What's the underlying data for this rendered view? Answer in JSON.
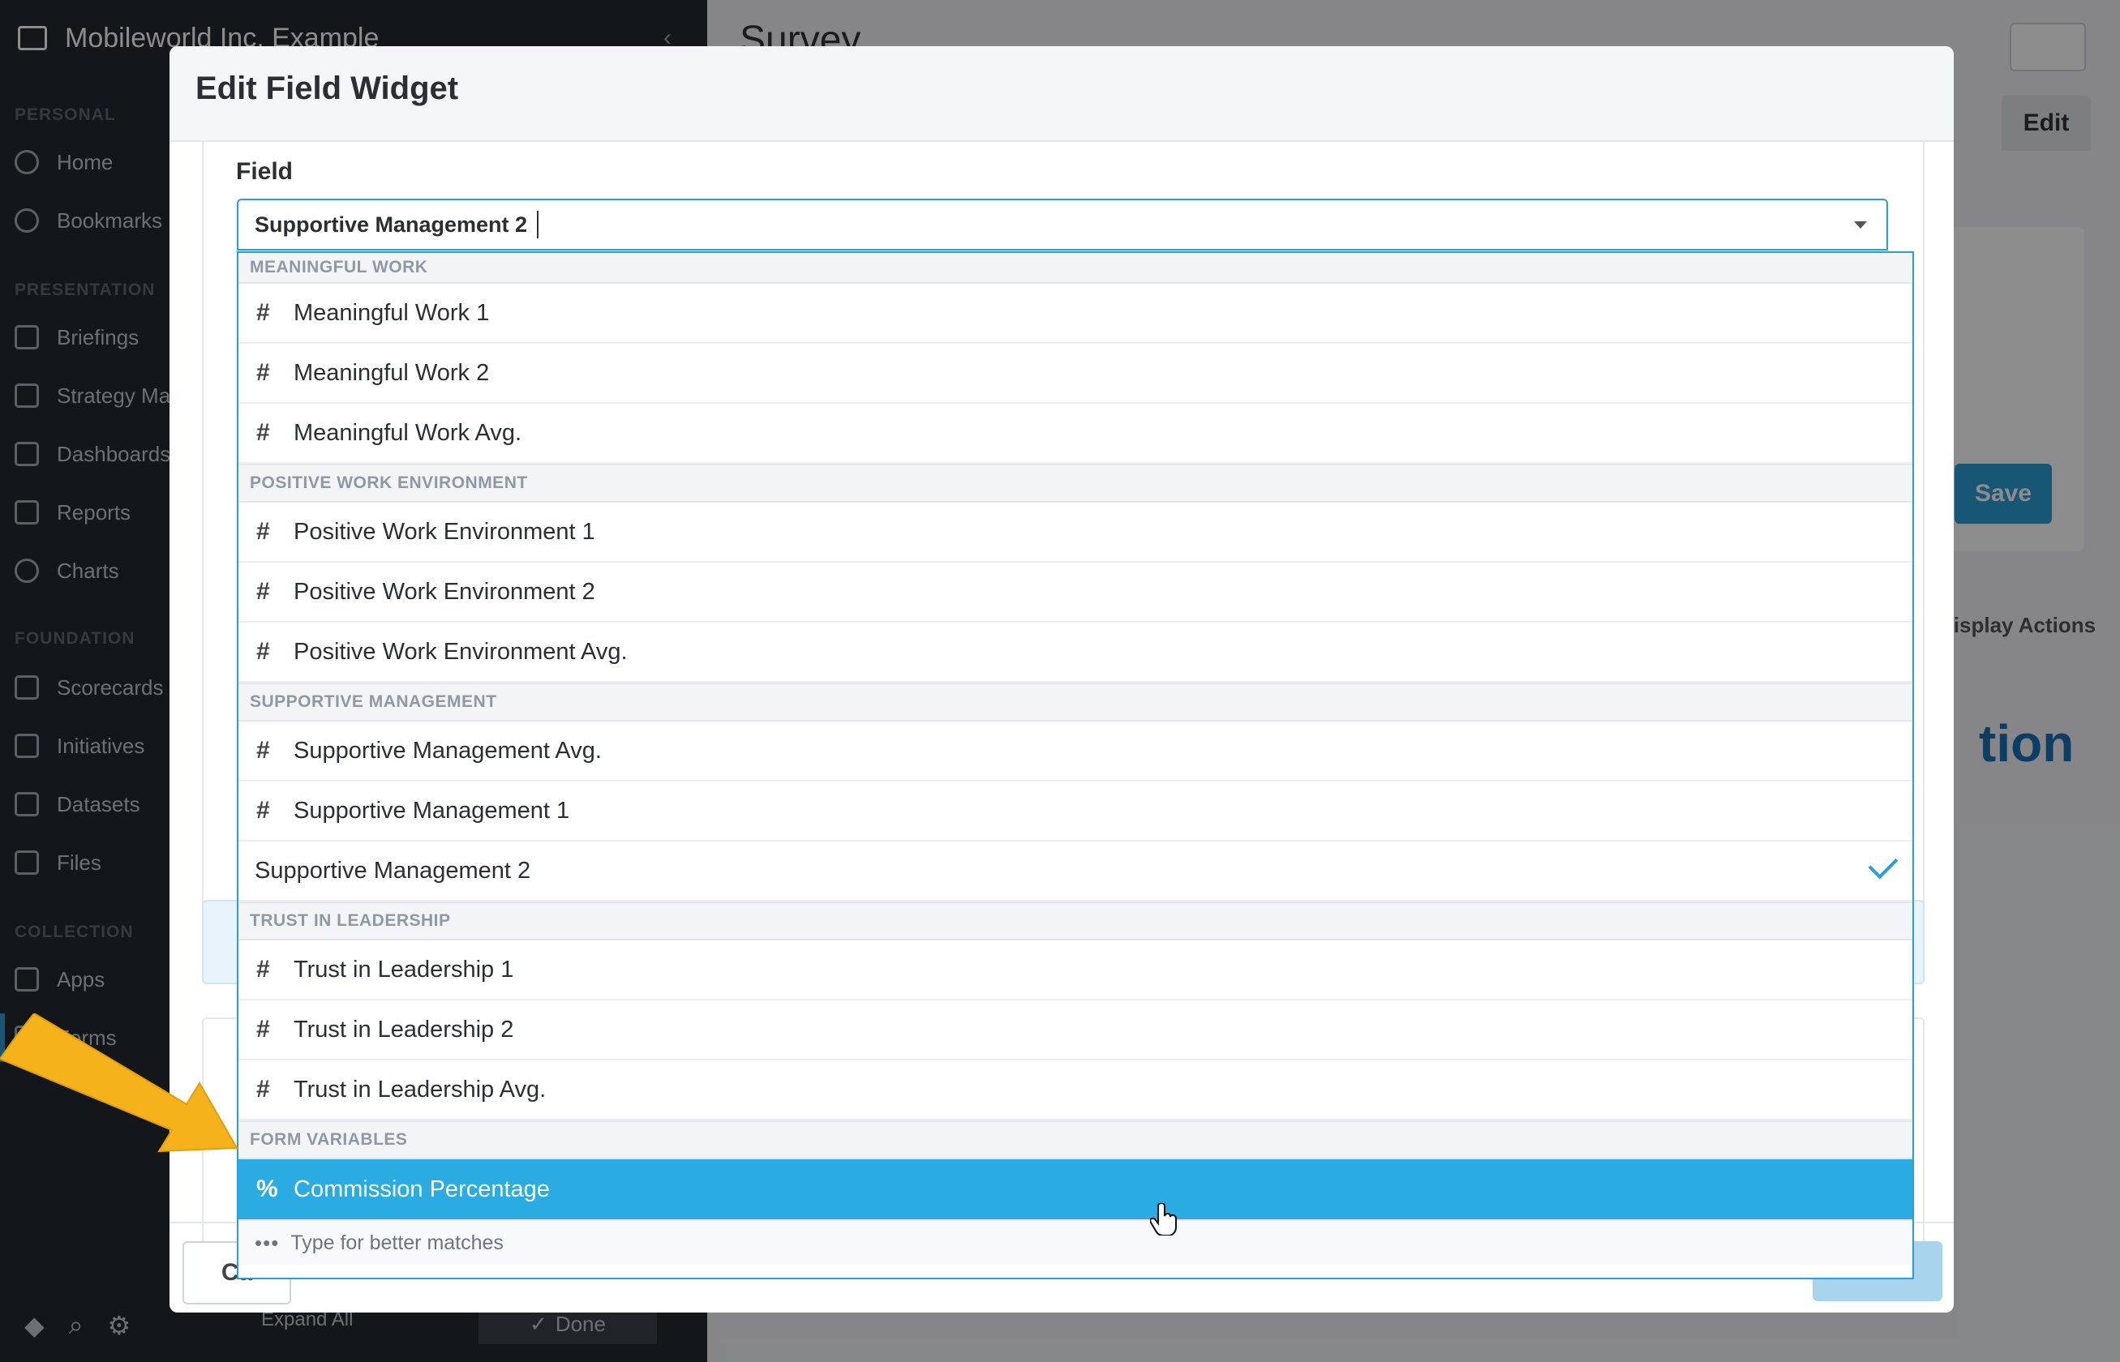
{
  "app": {
    "org_name": "Mobileworld Inc. Example",
    "page_title": "Survey",
    "edit_tab": "Edit",
    "save_label": "Save",
    "display_actions": "Display Actions",
    "big_text": "tion"
  },
  "sidebar": {
    "sections": [
      {
        "label": "PERSONAL",
        "items": [
          "Home",
          "Bookmarks"
        ]
      },
      {
        "label": "PRESENTATION",
        "items": [
          "Briefings",
          "Strategy Maps",
          "Dashboards",
          "Reports",
          "Charts"
        ]
      },
      {
        "label": "FOUNDATION",
        "items": [
          "Scorecards",
          "Initiatives",
          "Datasets",
          "Files"
        ]
      },
      {
        "label": "COLLECTION",
        "items": [
          "Apps",
          "Forms"
        ]
      }
    ],
    "expand_all": "Expand All",
    "done": "Done"
  },
  "modal": {
    "title": "Edit Field Widget",
    "field_label": "Field",
    "selected_value": "Supportive Management 2",
    "cancel_label": "Ca"
  },
  "dropdown": {
    "groups": [
      {
        "label": "MEANINGFUL WORK",
        "options": [
          "Meaningful Work 1",
          "Meaningful Work 2",
          "Meaningful Work Avg."
        ]
      },
      {
        "label": "POSITIVE WORK ENVIRONMENT",
        "options": [
          "Positive Work Environment 1",
          "Positive Work Environment 2",
          "Positive Work Environment Avg."
        ]
      },
      {
        "label": "SUPPORTIVE MANAGEMENT",
        "options": [
          "Supportive Management Avg.",
          "Supportive Management 1",
          "Supportive Management 2"
        ]
      },
      {
        "label": "TRUST IN LEADERSHIP",
        "options": [
          "Trust in Leadership 1",
          "Trust in Leadership 2",
          "Trust in Leadership Avg."
        ]
      },
      {
        "label": "FORM VARIABLES",
        "options": [
          "Commission Percentage"
        ]
      }
    ],
    "number_glyph": "#",
    "percent_glyph": "%",
    "more_dots": "•••",
    "more_hint": "Type for better matches"
  },
  "colors": {
    "accent": "#2a9fd6",
    "highlight": "#2aace2",
    "annotation_arrow": "#f5b21b"
  }
}
